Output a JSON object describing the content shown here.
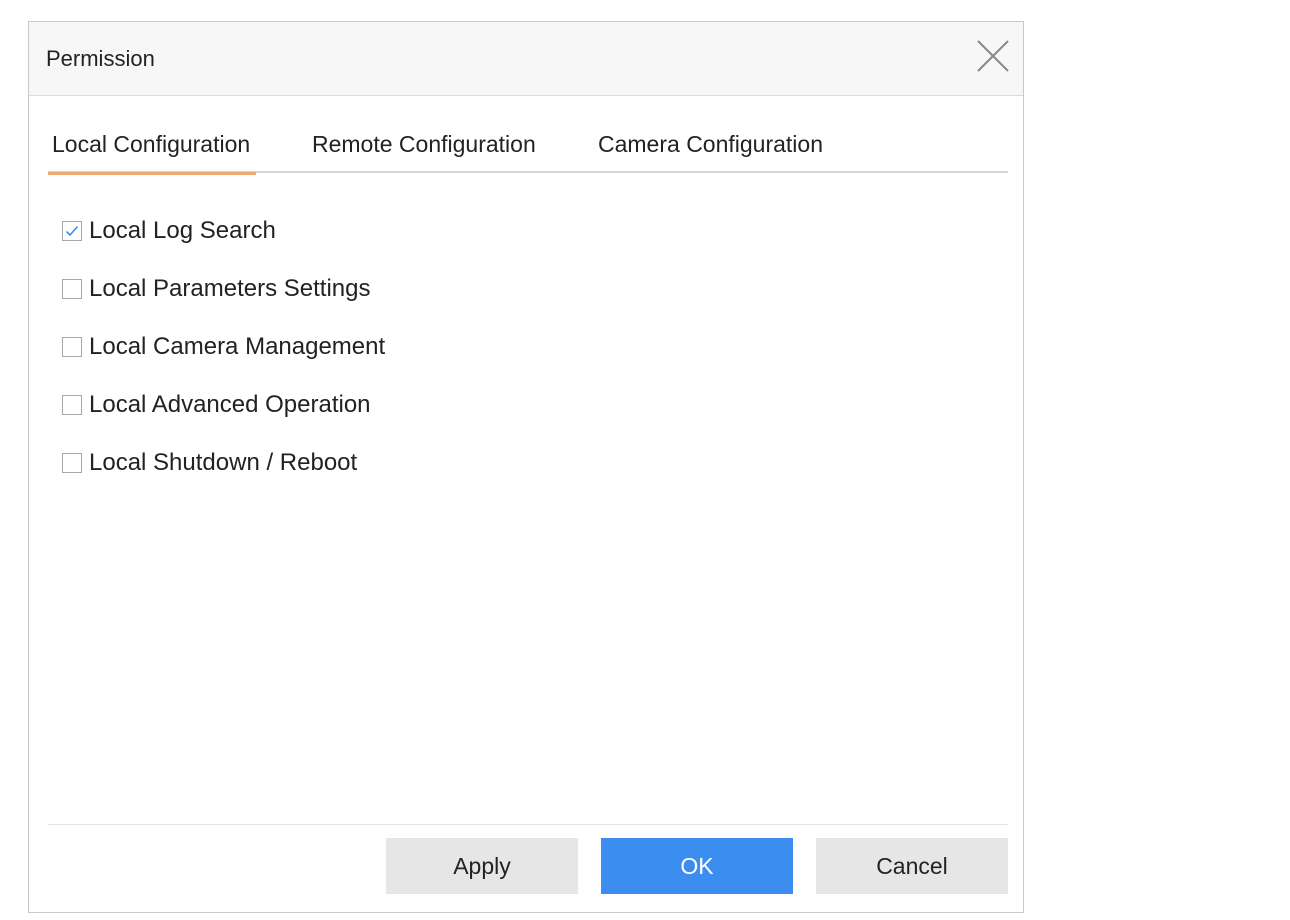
{
  "dialog": {
    "title": "Permission",
    "close_icon": "close-icon"
  },
  "tabs": [
    {
      "label": "Local Configuration",
      "active": true
    },
    {
      "label": "Remote Configuration",
      "active": false
    },
    {
      "label": "Camera Configuration",
      "active": false
    }
  ],
  "options": [
    {
      "label": "Local Log Search",
      "checked": true
    },
    {
      "label": "Local Parameters Settings",
      "checked": false
    },
    {
      "label": "Local Camera Management",
      "checked": false
    },
    {
      "label": "Local Advanced Operation",
      "checked": false
    },
    {
      "label": "Local Shutdown / Reboot",
      "checked": false
    }
  ],
  "buttons": {
    "apply": "Apply",
    "ok": "OK",
    "cancel": "Cancel"
  },
  "colors": {
    "accent_tab_underline": "#f0a878",
    "primary_button": "#3b8ef0",
    "checkmark": "#3b8ef0"
  }
}
